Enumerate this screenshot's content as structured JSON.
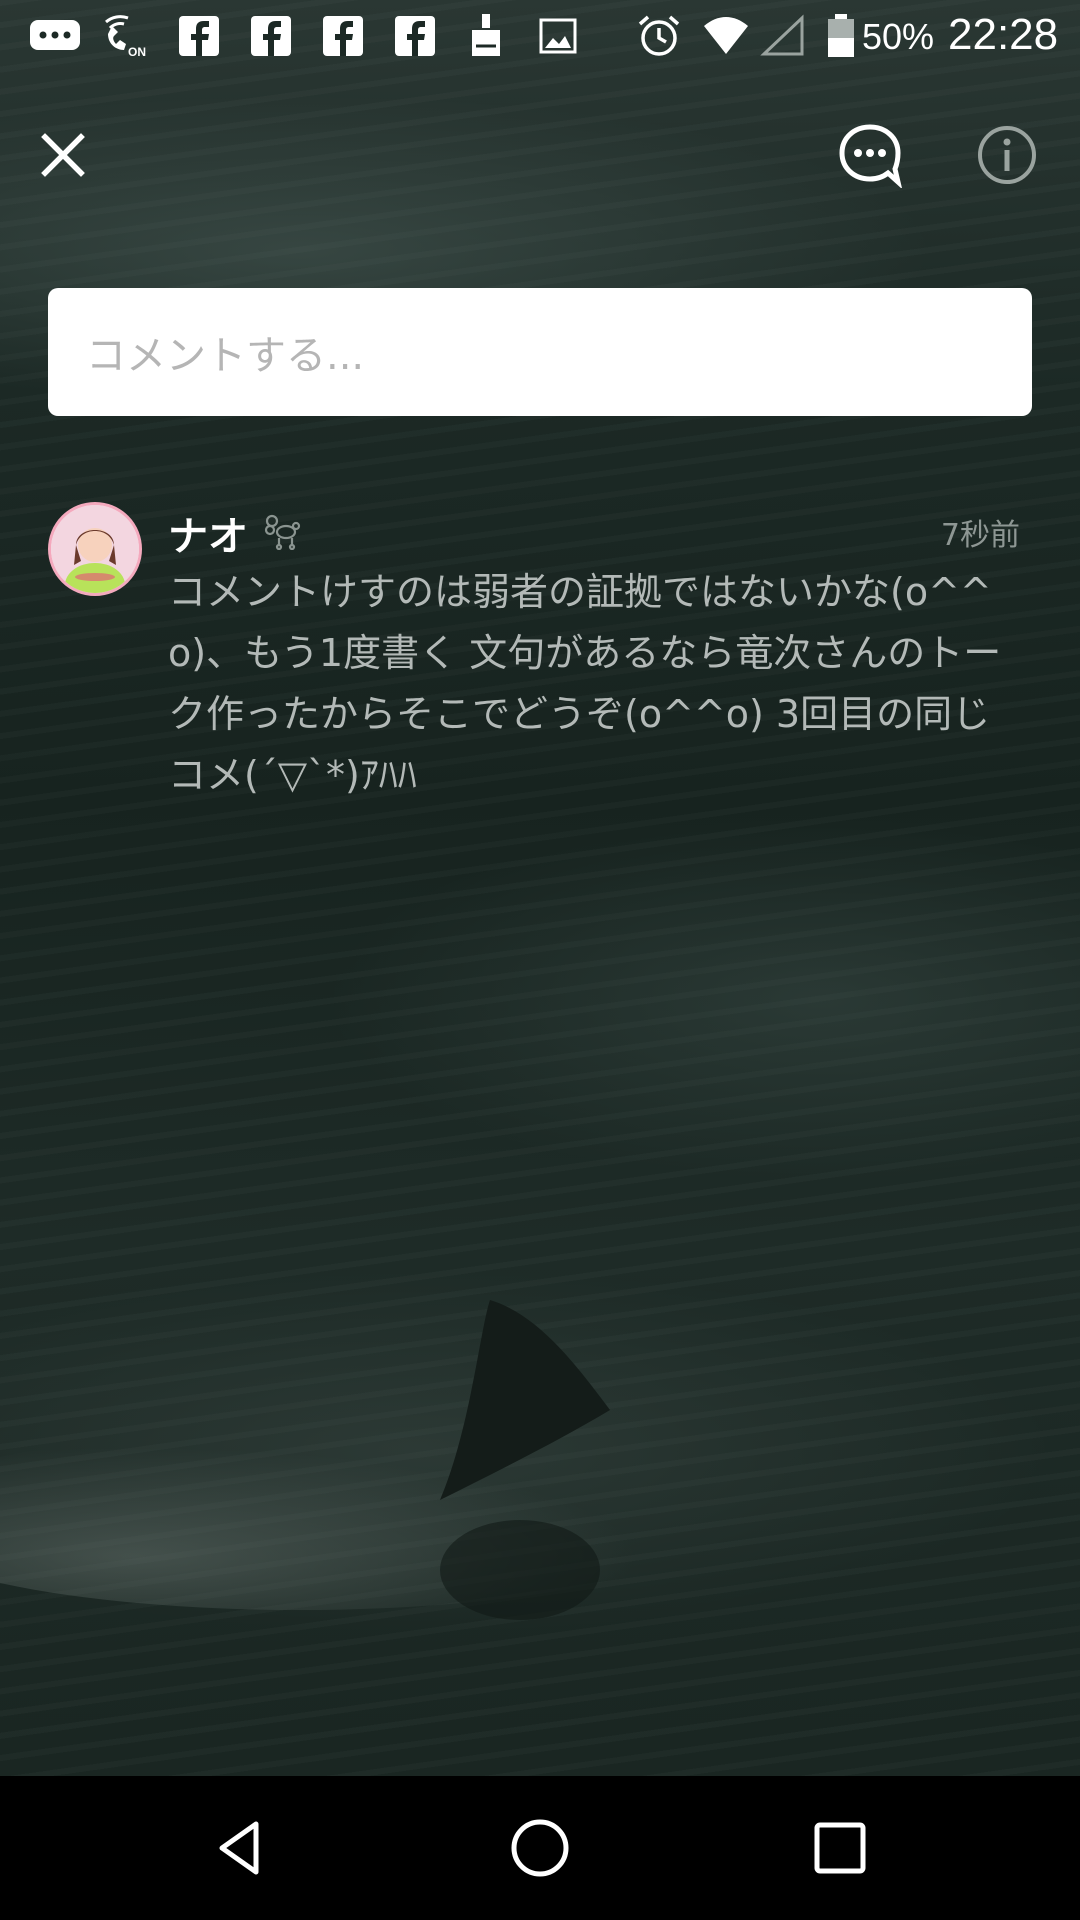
{
  "status_bar": {
    "battery": "50%",
    "time": "22:28",
    "icons": [
      "chat-notification-icon",
      "wifi-calling-on-icon",
      "facebook-icon",
      "facebook-icon",
      "facebook-icon",
      "facebook-icon",
      "cleaner-icon",
      "gallery-icon",
      "alarm-icon",
      "wifi-icon",
      "signal-icon",
      "battery-icon"
    ]
  },
  "toolbar": {
    "close_icon": "close-icon",
    "chat_icon": "chat-bubble-icon",
    "info_icon": "info-icon"
  },
  "comment_input": {
    "placeholder": "コメントする..."
  },
  "comments": [
    {
      "author": "ナオ",
      "badge_icon": "poodle-badge-icon",
      "timestamp": "7秒前",
      "text": "コメントけすのは弱者の証拠ではないかな(o^^o)、もう1度書く 文句があるなら竜次さんのトーク作ったからそこでどうぞ(o^^o) 3回目の同じコメ(´▽`*)ｱﾊﾊ"
    }
  ],
  "nav_bar": {
    "back_icon": "back-icon",
    "home_icon": "home-icon",
    "recents_icon": "recents-icon"
  },
  "colors": {
    "background": "#1c2925",
    "input_bg": "#ffffff",
    "placeholder": "#b5b5b5",
    "comment_text": "#b3b9b7",
    "timestamp": "#8e9794",
    "nav_bar": "#000000"
  }
}
